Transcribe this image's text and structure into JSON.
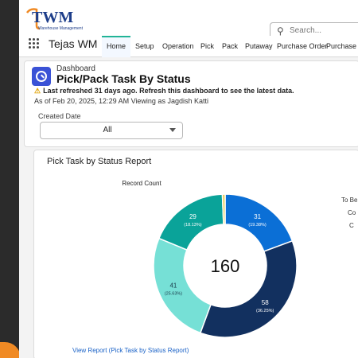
{
  "header": {
    "logo_text": "TWM",
    "logo_sub": "Warehouse Management",
    "search_placeholder": "Search..."
  },
  "nav": {
    "app_name": "Tejas WM",
    "tabs": [
      {
        "label": "Home",
        "active": true
      },
      {
        "label": "Setup"
      },
      {
        "label": "Operation"
      },
      {
        "label": "Pick"
      },
      {
        "label": "Pack"
      },
      {
        "label": "Putaway"
      },
      {
        "label": "Purchase Order"
      },
      {
        "label": "Purchase Orde"
      }
    ]
  },
  "dashboard": {
    "label": "Dashboard",
    "title": "Pick/Pack Task By Status",
    "warning": "Last refreshed 31 days ago. Refresh this dashboard to see the latest data.",
    "as_of": "As of Feb 20, 2025, 12:29 AM Viewing as Jagdish Katti",
    "filter_label": "Created Date",
    "filter_value": "All"
  },
  "report": {
    "title": "Pick Task by Status Report",
    "view_link": "View Report (Pick Task by Status Report)",
    "legend_partial": [
      "To Be",
      "Co",
      "C"
    ]
  },
  "colors": {
    "accent": "#21b497",
    "brand_blue": "#1e3e8a",
    "link": "#1a62c7"
  },
  "chart_data": {
    "type": "donut",
    "title": "Record Count",
    "total": "160",
    "slices": [
      {
        "value": 31,
        "label": "31",
        "pct": "(19.38%)",
        "color": "#0b6fd6"
      },
      {
        "value": 58,
        "label": "58",
        "pct": "(36.25%)",
        "color": "#12305f"
      },
      {
        "value": 41,
        "label": "41",
        "pct": "(25.63%)",
        "color": "#76e0d6"
      },
      {
        "value": 29,
        "label": "29",
        "pct": "(18.13%)",
        "color": "#0aa399"
      },
      {
        "value": 1,
        "label": "",
        "pct": "",
        "color": "#e8c84a"
      }
    ]
  }
}
